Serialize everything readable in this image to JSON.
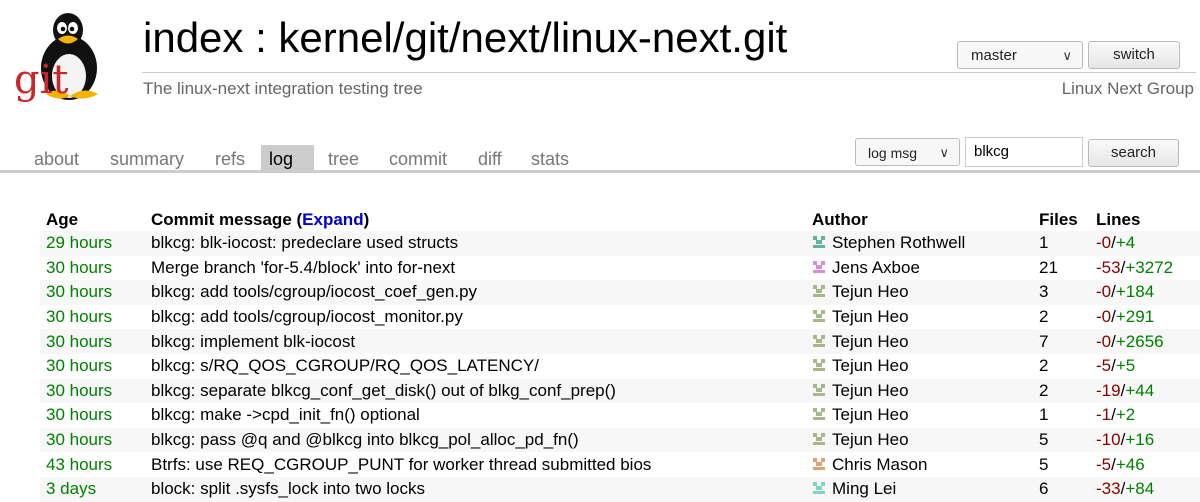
{
  "header": {
    "logo_text": "git",
    "title": "index : kernel/git/next/linux-next.git",
    "description": "The linux-next integration testing tree",
    "owner": "Linux Next Group",
    "branch_select": "master",
    "switch_label": "switch"
  },
  "tabs": [
    {
      "label": "about"
    },
    {
      "label": "summary"
    },
    {
      "label": "refs"
    },
    {
      "label": "log",
      "active": true
    },
    {
      "label": "tree"
    },
    {
      "label": "commit"
    },
    {
      "label": "diff"
    },
    {
      "label": "stats"
    }
  ],
  "search": {
    "type_select": "log msg",
    "query": "blkcg",
    "button_label": "search"
  },
  "table": {
    "headers": {
      "age": "Age",
      "message_prefix": "Commit message (",
      "expand": "Expand",
      "message_suffix": ")",
      "author": "Author",
      "files": "Files",
      "lines": "Lines"
    },
    "rows": [
      {
        "age": "29 hours",
        "message": "blkcg: blk-iocost: predeclare used structs",
        "author": "Stephen Rothwell",
        "avatar_color": "#5fb3a1",
        "files": "1",
        "deleted": "-0",
        "added": "+4"
      },
      {
        "age": "30 hours",
        "message": "Merge branch 'for-5.4/block' into for-next",
        "author": "Jens Axboe",
        "avatar_color": "#d98ad9",
        "files": "21",
        "deleted": "-53",
        "added": "+3272"
      },
      {
        "age": "30 hours",
        "message": "blkcg: add tools/cgroup/iocost_coef_gen.py",
        "author": "Tejun Heo",
        "avatar_color": "#a9b58a",
        "files": "3",
        "deleted": "-0",
        "added": "+184"
      },
      {
        "age": "30 hours",
        "message": "blkcg: add tools/cgroup/iocost_monitor.py",
        "author": "Tejun Heo",
        "avatar_color": "#a9b58a",
        "files": "2",
        "deleted": "-0",
        "added": "+291"
      },
      {
        "age": "30 hours",
        "message": "blkcg: implement blk-iocost",
        "author": "Tejun Heo",
        "avatar_color": "#a9b58a",
        "files": "7",
        "deleted": "-0",
        "added": "+2656"
      },
      {
        "age": "30 hours",
        "message": "blkcg: s/RQ_QOS_CGROUP/RQ_QOS_LATENCY/",
        "author": "Tejun Heo",
        "avatar_color": "#a9b58a",
        "files": "2",
        "deleted": "-5",
        "added": "+5"
      },
      {
        "age": "30 hours",
        "message": "blkcg: separate blkcg_conf_get_disk() out of blkg_conf_prep()",
        "author": "Tejun Heo",
        "avatar_color": "#a9b58a",
        "files": "2",
        "deleted": "-19",
        "added": "+44"
      },
      {
        "age": "30 hours",
        "message": "blkcg: make ->cpd_init_fn() optional",
        "author": "Tejun Heo",
        "avatar_color": "#a9b58a",
        "files": "1",
        "deleted": "-1",
        "added": "+2"
      },
      {
        "age": "30 hours",
        "message": "blkcg: pass @q and @blkcg into blkcg_pol_alloc_pd_fn()",
        "author": "Tejun Heo",
        "avatar_color": "#a9b58a",
        "files": "5",
        "deleted": "-10",
        "added": "+16"
      },
      {
        "age": "43 hours",
        "message": "Btrfs: use REQ_CGROUP_PUNT for worker thread submitted bios",
        "author": "Chris Mason",
        "avatar_color": "#e0a070",
        "files": "5",
        "deleted": "-5",
        "added": "+46"
      },
      {
        "age": "3 days",
        "message": "block: split .sysfs_lock into two locks",
        "author": "Ming Lei",
        "avatar_color": "#7fd6c0",
        "files": "6",
        "deleted": "-33",
        "added": "+84"
      }
    ]
  }
}
